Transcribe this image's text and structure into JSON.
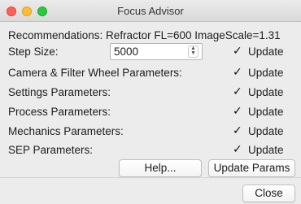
{
  "window": {
    "title": "Focus Advisor"
  },
  "recommendation": "Recommendations: Refractor FL=600 ImageScale=1.31",
  "step_size": {
    "label": "Step Size:",
    "value": "5000",
    "update_label": "Update"
  },
  "rows": [
    {
      "label": "Camera & Filter Wheel Parameters:",
      "update_label": "Update"
    },
    {
      "label": "Settings Parameters:",
      "update_label": "Update"
    },
    {
      "label": "Process Parameters:",
      "update_label": "Update"
    },
    {
      "label": "Mechanics Parameters:",
      "update_label": "Update"
    },
    {
      "label": "SEP Parameters:",
      "update_label": "Update"
    }
  ],
  "buttons": {
    "help": "Help...",
    "update_params": "Update Params",
    "close": "Close"
  }
}
